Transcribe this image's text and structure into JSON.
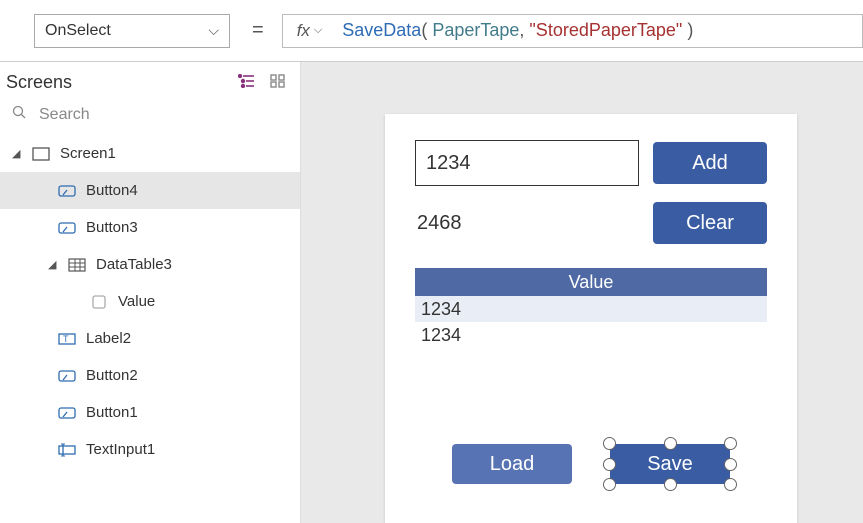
{
  "property_selector": {
    "value": "OnSelect"
  },
  "formula": {
    "fn": "SaveData",
    "arg1": "PaperTape",
    "arg2": "\"StoredPaperTape\""
  },
  "panel": {
    "title": "Screens",
    "search_placeholder": "Search"
  },
  "tree": {
    "screen1": "Screen1",
    "button4": "Button4",
    "button3": "Button3",
    "datatable3": "DataTable3",
    "value_col": "Value",
    "label2": "Label2",
    "button2": "Button2",
    "button1": "Button1",
    "textinput1": "TextInput1"
  },
  "app": {
    "input_value": "1234",
    "label_value": "2468",
    "btn_add": "Add",
    "btn_clear": "Clear",
    "table_header": "Value",
    "table_rows": [
      "1234",
      "1234"
    ],
    "btn_load": "Load",
    "btn_save": "Save"
  }
}
